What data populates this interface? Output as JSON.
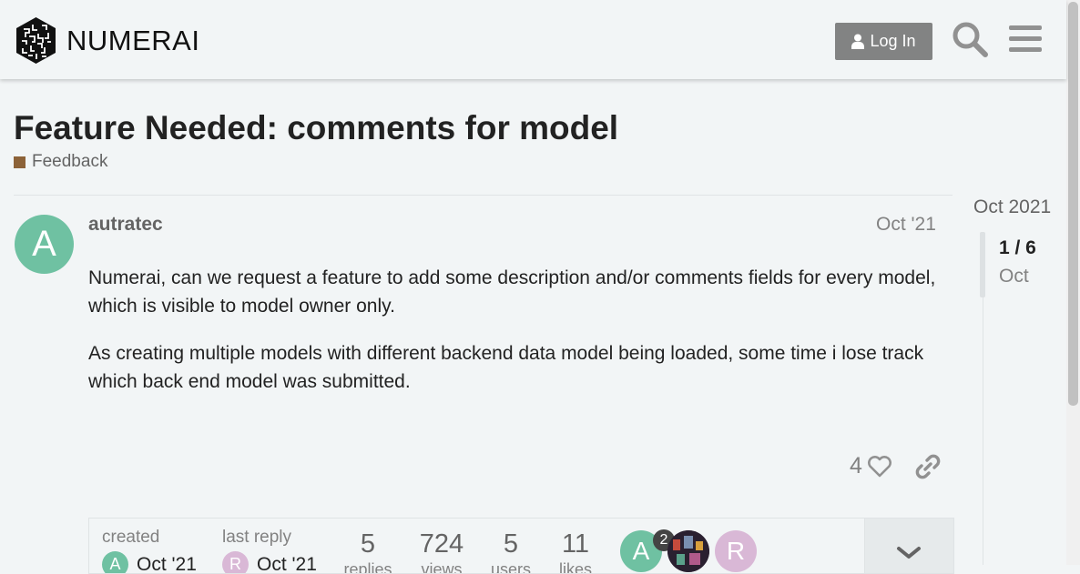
{
  "header": {
    "logo_text": "NUMERAI",
    "login_label": "Log In"
  },
  "topic": {
    "title": "Feature Needed: comments for model",
    "category": "Feedback",
    "category_color": "#8c6238"
  },
  "post": {
    "avatar_letter": "A",
    "avatar_color": "#6fc1a2",
    "username": "autratec",
    "date": "Oct '21",
    "paragraphs": [
      "Numerai, can we request a feature to add some description and/or comments fields for every model, which is visible to model owner only.",
      "As creating multiple models with different backend data model being loaded, some time i lose track which back end model was submitted."
    ],
    "like_count": "4"
  },
  "summary": {
    "created_label": "created",
    "created_date": "Oct '21",
    "created_avatar": "A",
    "last_reply_label": "last reply",
    "last_reply_date": "Oct '21",
    "last_reply_avatar": "R",
    "replies_count": "5",
    "replies_label": "replies",
    "views_count": "724",
    "views_label": "views",
    "users_count": "5",
    "users_label": "users",
    "likes_count": "11",
    "likes_label": "likes",
    "participants": [
      {
        "letter": "A",
        "color": "#6fc1a2",
        "posts": "2"
      },
      {
        "letter": "",
        "color": "#3a2a3a"
      },
      {
        "letter": "R",
        "color": "#d9b8d6"
      }
    ]
  },
  "timeline": {
    "date": "Oct 2021",
    "position": "1 / 6",
    "sub": "Oct"
  }
}
